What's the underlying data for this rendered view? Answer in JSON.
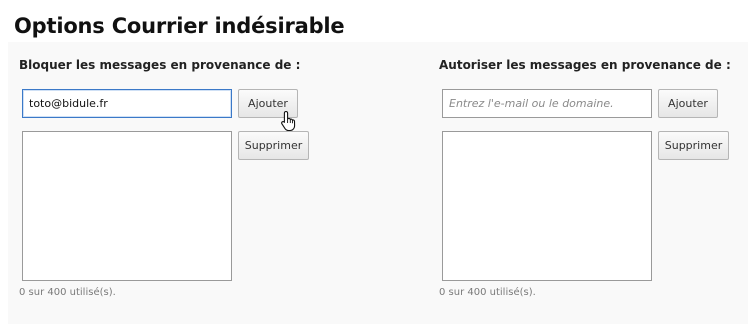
{
  "page": {
    "title": "Options Courrier indésirable"
  },
  "blocked": {
    "label": "Bloquer les messages en provenance de :",
    "input_value": "toto@bidule.fr",
    "add_label": "Ajouter",
    "remove_label": "Supprimer",
    "usage": "0 sur 400 utilisé(s)."
  },
  "allowed": {
    "label": "Autoriser les messages en provenance de :",
    "input_placeholder": "Entrez l'e-mail ou le domaine.",
    "add_label": "Ajouter",
    "remove_label": "Supprimer",
    "usage": "0 sur 400 utilisé(s)."
  },
  "colors": {
    "focus_border": "#3b79c8",
    "background": "#f9f9f9"
  },
  "icons": {
    "pointer": "hand-pointer-cursor-icon"
  }
}
